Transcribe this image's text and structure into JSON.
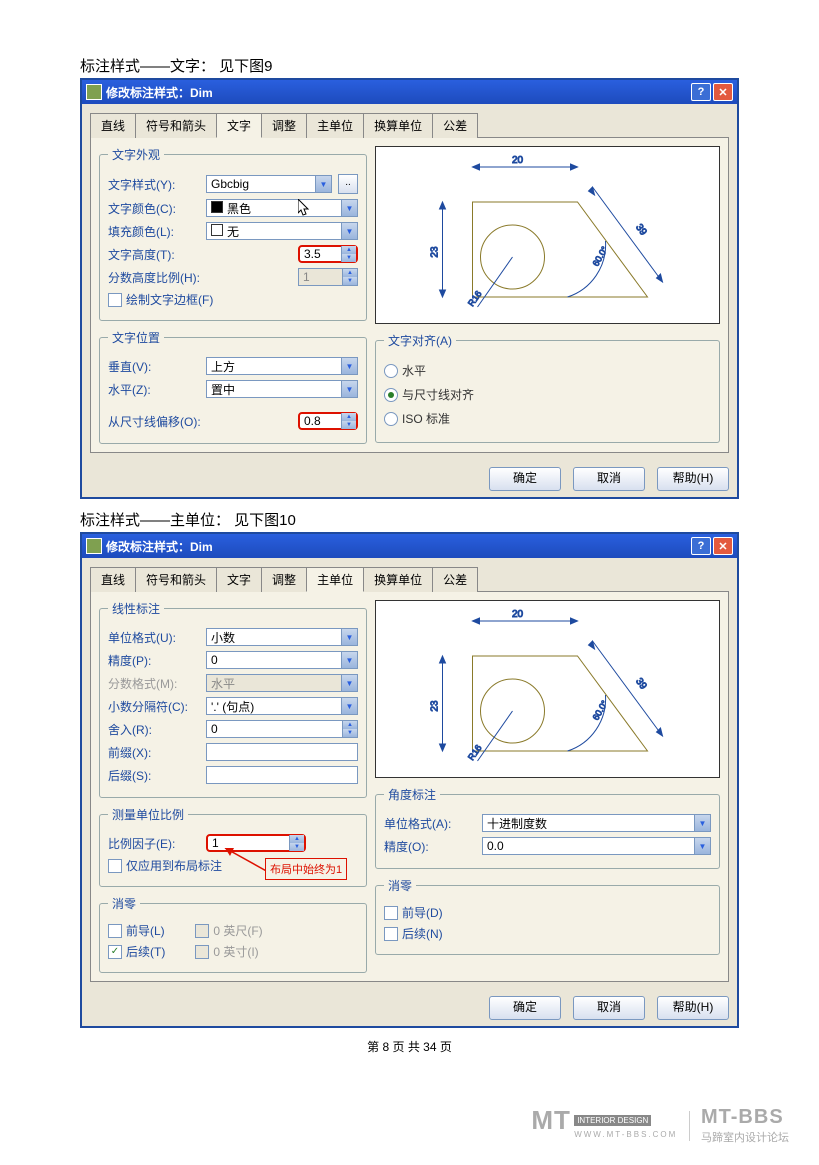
{
  "caption1": "标注样式——文字：  见下图9",
  "caption2": "标注样式——主单位：  见下图10",
  "dialog_title": "修改标注样式：Dim",
  "tabs": [
    "直线",
    "符号和箭头",
    "文字",
    "调整",
    "主单位",
    "换算单位",
    "公差"
  ],
  "dlg1": {
    "appearance": {
      "legend": "文字外观",
      "style_label": "文字样式(Y):",
      "style_value": "Gbcbig",
      "color_label": "文字颜色(C):",
      "color_value": "黑色",
      "fill_label": "填充颜色(L):",
      "fill_value": "无",
      "height_label": "文字高度(T):",
      "height_value": "3.5",
      "frac_label": "分数高度比例(H):",
      "frac_value": "1",
      "frame_check": "绘制文字边框(F)"
    },
    "placement": {
      "legend": "文字位置",
      "vert_label": "垂直(V):",
      "vert_value": "上方",
      "horiz_label": "水平(Z):",
      "horiz_value": "置中",
      "offset_label": "从尺寸线偏移(O):",
      "offset_value": "0.8"
    },
    "align": {
      "legend": "文字对齐(A)",
      "opt1": "水平",
      "opt2": "与尺寸线对齐",
      "opt3": "ISO 标准"
    }
  },
  "dlg2": {
    "linear": {
      "legend": "线性标注",
      "format_label": "单位格式(U):",
      "format_value": "小数",
      "precision_label": "精度(P):",
      "precision_value": "0",
      "frac_format_label": "分数格式(M):",
      "frac_format_value": "水平",
      "sep_label": "小数分隔符(C):",
      "sep_value": "'.' (句点)",
      "round_label": "舍入(R):",
      "round_value": "0",
      "prefix_label": "前缀(X):",
      "suffix_label": "后缀(S):"
    },
    "scale": {
      "legend": "测量单位比例",
      "factor_label": "比例因子(E):",
      "factor_value": "1",
      "layout_check": "仅应用到布局标注",
      "annotation": "布局中始终为1"
    },
    "zero_l": {
      "legend": "消零",
      "leading": "前导(L)",
      "trailing": "后续(T)",
      "feet": "0 英尺(F)",
      "inch": "0 英寸(I)"
    },
    "angular": {
      "legend": "角度标注",
      "format_label": "单位格式(A):",
      "format_value": "十进制度数",
      "precision_label": "精度(O):",
      "precision_value": "0.0"
    },
    "zero_r": {
      "legend": "消零",
      "leading": "前导(D)",
      "trailing": "后续(N)"
    }
  },
  "buttons": {
    "ok": "确定",
    "cancel": "取消",
    "help": "帮助(H)"
  },
  "preview_dims": {
    "top": "20",
    "left": "23",
    "right": "39",
    "angle": "60.0°",
    "radius": "R16"
  },
  "footer": "第 8 页 共 34 页",
  "wm": {
    "brand": "MT",
    "sub1": "INTERIOR DESIGN",
    "sub2": "WWW.MT-BBS.COM",
    "bbs": "MT-BBS",
    "cn": "马蹄室内设计论坛"
  }
}
